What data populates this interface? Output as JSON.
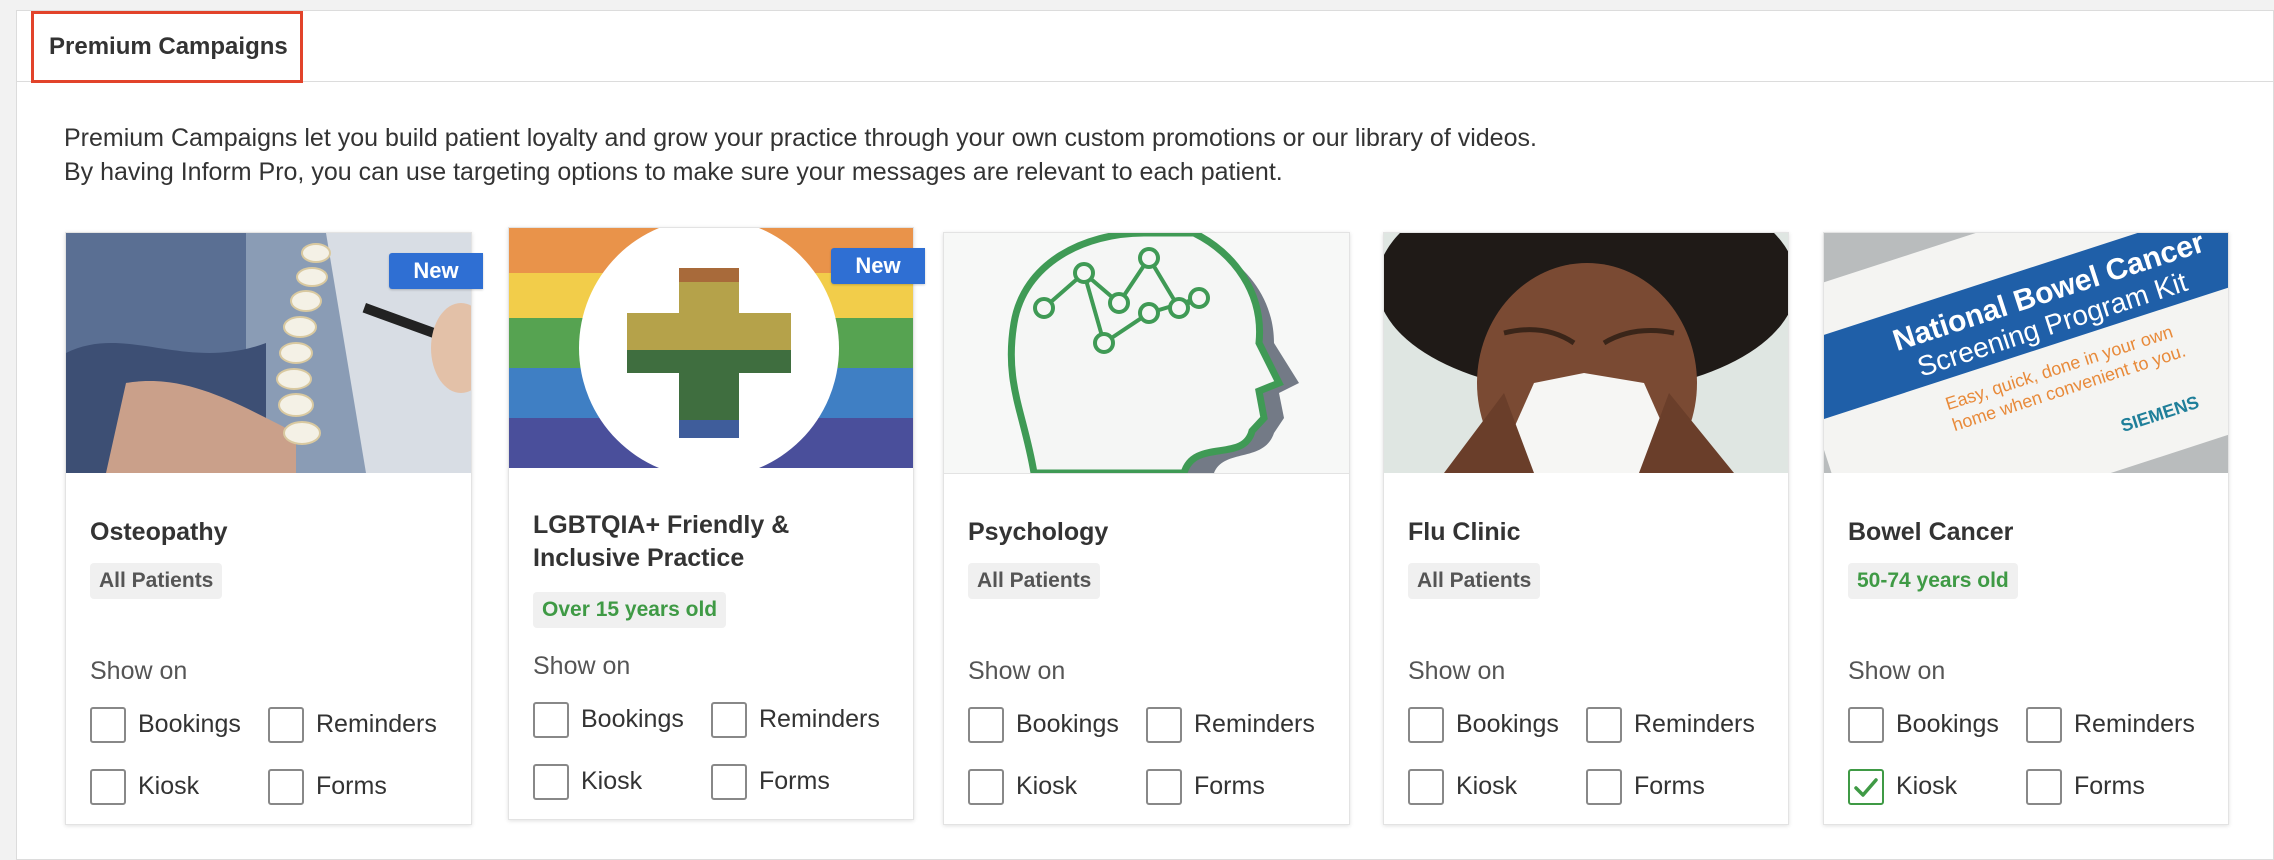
{
  "panel": {
    "title": "Premium Campaigns",
    "description_line_1": "Premium Campaigns let you build patient loyalty and grow your practice through your own custom promotions or our library of videos.",
    "description_line_2": "By having Inform Pro, you can use targeting options to make sure your messages are relevant to each patient."
  },
  "labels": {
    "new_badge": "New",
    "show_on": "Show on",
    "bookings": "Bookings",
    "reminders": "Reminders",
    "kiosk": "Kiosk",
    "forms": "Forms"
  },
  "campaigns": [
    {
      "title": "Osteopathy",
      "audience": "All Patients",
      "audience_style": "grey",
      "is_new": true,
      "image": "spine-model-photo",
      "checks": {
        "bookings": false,
        "reminders": false,
        "kiosk": false,
        "forms": false
      }
    },
    {
      "title_line_1": "LGBTQIA+ Friendly &",
      "title_line_2": "Inclusive Practice",
      "audience": "Over 15 years old",
      "audience_style": "green",
      "is_new": true,
      "image": "rainbow-cross-graphic",
      "checks": {
        "bookings": false,
        "reminders": false,
        "kiosk": false,
        "forms": false
      }
    },
    {
      "title": "Psychology",
      "audience": "All Patients",
      "audience_style": "grey",
      "is_new": false,
      "image": "head-network-graphic",
      "checks": {
        "bookings": false,
        "reminders": false,
        "kiosk": false,
        "forms": false
      }
    },
    {
      "title": "Flu Clinic",
      "audience": "All Patients",
      "audience_style": "grey",
      "is_new": false,
      "image": "sneezing-person-photo",
      "checks": {
        "bookings": false,
        "reminders": false,
        "kiosk": false,
        "forms": false
      }
    },
    {
      "title": "Bowel Cancer",
      "audience": "50-74 years old",
      "audience_style": "green",
      "is_new": false,
      "image": "screening-kit-photo",
      "kit_text_line_1": "National Bowel Cancer",
      "kit_text_line_2": "Screening Program Kit",
      "kit_text_line_3": "Easy, quick, done in your own",
      "kit_text_line_4": "home when convenient to you.",
      "kit_brand": "SIEMENS",
      "checks": {
        "bookings": false,
        "reminders": false,
        "kiosk": true,
        "forms": false
      }
    }
  ],
  "colors": {
    "accent_red": "#e2432a",
    "badge_blue": "#2f6fd3",
    "green": "#3f9a45"
  }
}
